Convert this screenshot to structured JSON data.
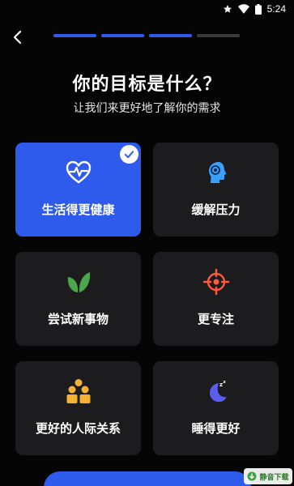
{
  "status": {
    "time": "5:24"
  },
  "progress": {
    "total_steps": 4,
    "completed_steps": 3
  },
  "page": {
    "title": "你的目标是什么？",
    "subtitle": "让我们来更好地了解你的需求"
  },
  "goals": [
    {
      "label": "生活得更健康",
      "icon": "heart-pulse-icon",
      "selected": true
    },
    {
      "label": "缓解压力",
      "icon": "head-relief-icon",
      "selected": false
    },
    {
      "label": "尝试新事物",
      "icon": "leaf-icon",
      "selected": false
    },
    {
      "label": "更专注",
      "icon": "crosshair-icon",
      "selected": false
    },
    {
      "label": "更好的人际关系",
      "icon": "people-icon",
      "selected": false
    },
    {
      "label": "睡得更好",
      "icon": "moon-sleep-icon",
      "selected": false
    }
  ],
  "watermark": {
    "text": "静音下载"
  },
  "colors": {
    "accent": "#2f5bec",
    "card": "#1c1c1e",
    "heart": "#ffffff",
    "head": "#3aa0ff",
    "leaf": "#4ca64c",
    "crosshair": "#ff5a3c",
    "people": "#f4b233",
    "moon": "#5b5ff0"
  }
}
